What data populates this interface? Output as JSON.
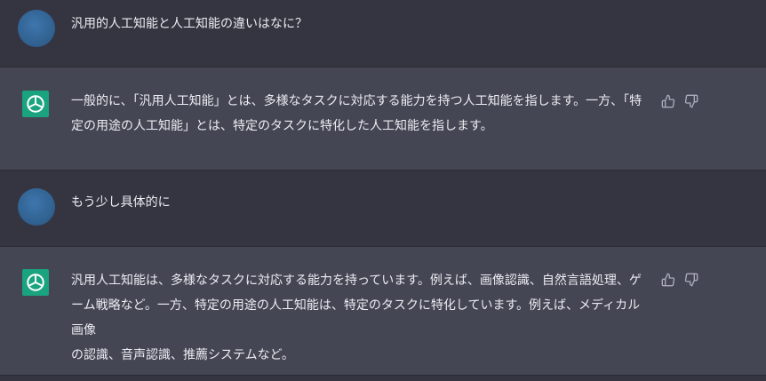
{
  "messages": [
    {
      "role": "user",
      "text": "汎用的人工知能と人工知能の違いはなに？"
    },
    {
      "role": "assistant",
      "text": "一般的に、「汎用人工知能」とは、多様なタスクに対応する能力を持つ人工知能を指します。一方、「特\n定の用途の人工知能」とは、特定のタスクに特化した人工知能を指します。"
    },
    {
      "role": "user",
      "text": "もう少し具体的に"
    },
    {
      "role": "assistant",
      "text": "汎用人工知能は、多様なタスクに対応する能力を持っています。例えば、画像認識、自然言語処理、ゲ\nーム戦略など。一方、特定の用途の人工知能は、特定のタスクに特化しています。例えば、メディカル画像\nの認識、音声認識、推薦システムなど。"
    }
  ],
  "icons": {
    "user_avatar": "user-avatar",
    "bot_avatar": "openai-logo-icon",
    "like": "thumbs-up-icon",
    "dislike": "thumbs-down-icon"
  }
}
